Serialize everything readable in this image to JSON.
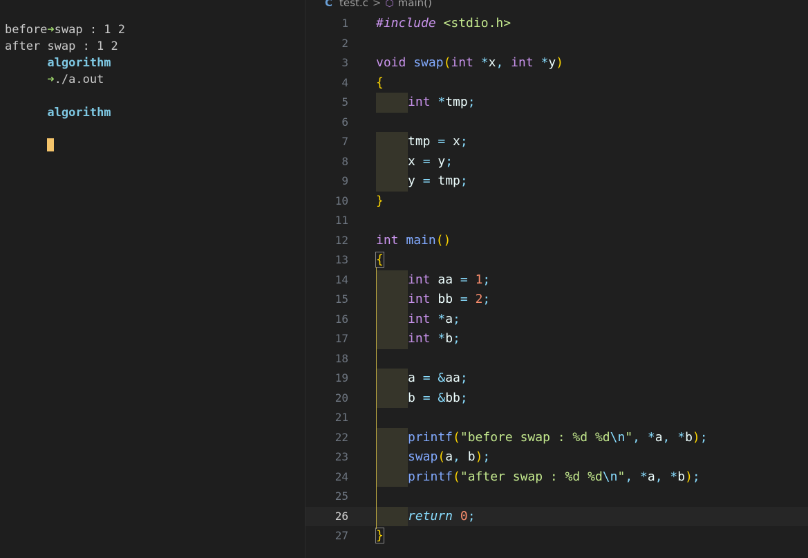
{
  "terminal": {
    "lines": [
      {
        "prompt": "➜",
        "dir": "algorithm",
        "cmd": " ./a.out"
      },
      {
        "text": "before swap : 1 2"
      },
      {
        "text": "after swap : 1 2"
      },
      {
        "prompt": "➜",
        "dir": "algorithm",
        "cmd": ""
      }
    ]
  },
  "editor": {
    "breadcrumb": {
      "file_icon": "C",
      "file": "test.c",
      "separator": ">",
      "symbol_icon": "cube-icon",
      "symbol": "main()"
    },
    "current_line": 26,
    "lines": [
      {
        "n": "1",
        "indent": 0,
        "tokens": [
          [
            "pre",
            "#include"
          ],
          [
            "",
            " "
          ],
          [
            "inc",
            "<stdio.h>"
          ]
        ]
      },
      {
        "n": "2",
        "indent": 0,
        "tokens": []
      },
      {
        "n": "3",
        "indent": 0,
        "tokens": [
          [
            "kw",
            "void"
          ],
          [
            "",
            " "
          ],
          [
            "fn",
            "swap"
          ],
          [
            "br",
            "("
          ],
          [
            "kw",
            "int"
          ],
          [
            "",
            " "
          ],
          [
            "op",
            "*"
          ],
          [
            "var",
            "x"
          ],
          [
            "punc",
            ","
          ],
          [
            "",
            " "
          ],
          [
            "kw",
            "int"
          ],
          [
            "",
            " "
          ],
          [
            "op",
            "*"
          ],
          [
            "var",
            "y"
          ],
          [
            "br",
            ")"
          ]
        ]
      },
      {
        "n": "4",
        "indent": 0,
        "tokens": [
          [
            "br",
            "{"
          ]
        ]
      },
      {
        "n": "5",
        "indent": 1,
        "tokens": [
          [
            "kw",
            "int"
          ],
          [
            "",
            " "
          ],
          [
            "op",
            "*"
          ],
          [
            "var",
            "tmp"
          ],
          [
            "punc",
            ";"
          ]
        ]
      },
      {
        "n": "6",
        "indent": 0,
        "tokens": []
      },
      {
        "n": "7",
        "indent": 1,
        "tokens": [
          [
            "var",
            "tmp"
          ],
          [
            "",
            " "
          ],
          [
            "op",
            "="
          ],
          [
            "",
            " "
          ],
          [
            "var",
            "x"
          ],
          [
            "punc",
            ";"
          ]
        ]
      },
      {
        "n": "8",
        "indent": 1,
        "tokens": [
          [
            "var",
            "x"
          ],
          [
            "",
            " "
          ],
          [
            "op",
            "="
          ],
          [
            "",
            " "
          ],
          [
            "var",
            "y"
          ],
          [
            "punc",
            ";"
          ]
        ]
      },
      {
        "n": "9",
        "indent": 1,
        "tokens": [
          [
            "var",
            "y"
          ],
          [
            "",
            " "
          ],
          [
            "op",
            "="
          ],
          [
            "",
            " "
          ],
          [
            "var",
            "tmp"
          ],
          [
            "punc",
            ";"
          ]
        ]
      },
      {
        "n": "10",
        "indent": 0,
        "tokens": [
          [
            "br",
            "}"
          ]
        ]
      },
      {
        "n": "11",
        "indent": 0,
        "tokens": []
      },
      {
        "n": "12",
        "indent": 0,
        "tokens": [
          [
            "kw",
            "int"
          ],
          [
            "",
            " "
          ],
          [
            "fn",
            "main"
          ],
          [
            "br",
            "()"
          ]
        ]
      },
      {
        "n": "13",
        "indent": 0,
        "tokens": [
          [
            "br",
            "{"
          ]
        ],
        "box": true
      },
      {
        "n": "14",
        "indent": 1,
        "tokens": [
          [
            "kw",
            "int"
          ],
          [
            "",
            " "
          ],
          [
            "var",
            "aa"
          ],
          [
            "",
            " "
          ],
          [
            "op",
            "="
          ],
          [
            "",
            " "
          ],
          [
            "num",
            "1"
          ],
          [
            "punc",
            ";"
          ]
        ]
      },
      {
        "n": "15",
        "indent": 1,
        "tokens": [
          [
            "kw",
            "int"
          ],
          [
            "",
            " "
          ],
          [
            "var",
            "bb"
          ],
          [
            "",
            " "
          ],
          [
            "op",
            "="
          ],
          [
            "",
            " "
          ],
          [
            "num",
            "2"
          ],
          [
            "punc",
            ";"
          ]
        ]
      },
      {
        "n": "16",
        "indent": 1,
        "tokens": [
          [
            "kw",
            "int"
          ],
          [
            "",
            " "
          ],
          [
            "op",
            "*"
          ],
          [
            "var",
            "a"
          ],
          [
            "punc",
            ";"
          ]
        ]
      },
      {
        "n": "17",
        "indent": 1,
        "tokens": [
          [
            "kw",
            "int"
          ],
          [
            "",
            " "
          ],
          [
            "op",
            "*"
          ],
          [
            "var",
            "b"
          ],
          [
            "punc",
            ";"
          ]
        ]
      },
      {
        "n": "18",
        "indent": 0,
        "tokens": []
      },
      {
        "n": "19",
        "indent": 1,
        "tokens": [
          [
            "var",
            "a"
          ],
          [
            "",
            " "
          ],
          [
            "op",
            "="
          ],
          [
            "",
            " "
          ],
          [
            "op",
            "&"
          ],
          [
            "var",
            "aa"
          ],
          [
            "punc",
            ";"
          ]
        ]
      },
      {
        "n": "20",
        "indent": 1,
        "tokens": [
          [
            "var",
            "b"
          ],
          [
            "",
            " "
          ],
          [
            "op",
            "="
          ],
          [
            "",
            " "
          ],
          [
            "op",
            "&"
          ],
          [
            "var",
            "bb"
          ],
          [
            "punc",
            ";"
          ]
        ]
      },
      {
        "n": "21",
        "indent": 0,
        "tokens": []
      },
      {
        "n": "22",
        "indent": 1,
        "tokens": [
          [
            "fn",
            "printf"
          ],
          [
            "br",
            "("
          ],
          [
            "str",
            "\"before swap : %d %d"
          ],
          [
            "esc",
            "\\n"
          ],
          [
            "str",
            "\""
          ],
          [
            "punc",
            ","
          ],
          [
            "",
            " "
          ],
          [
            "op",
            "*"
          ],
          [
            "var",
            "a"
          ],
          [
            "punc",
            ","
          ],
          [
            "",
            " "
          ],
          [
            "op",
            "*"
          ],
          [
            "var",
            "b"
          ],
          [
            "br",
            ")"
          ],
          [
            "punc",
            ";"
          ]
        ]
      },
      {
        "n": "23",
        "indent": 1,
        "tokens": [
          [
            "fn",
            "swap"
          ],
          [
            "br",
            "("
          ],
          [
            "var",
            "a"
          ],
          [
            "punc",
            ","
          ],
          [
            "",
            " "
          ],
          [
            "var",
            "b"
          ],
          [
            "br",
            ")"
          ],
          [
            "punc",
            ";"
          ]
        ]
      },
      {
        "n": "24",
        "indent": 1,
        "tokens": [
          [
            "fn",
            "printf"
          ],
          [
            "br",
            "("
          ],
          [
            "str",
            "\"after swap : %d %d"
          ],
          [
            "esc",
            "\\n"
          ],
          [
            "str",
            "\""
          ],
          [
            "punc",
            ","
          ],
          [
            "",
            " "
          ],
          [
            "op",
            "*"
          ],
          [
            "var",
            "a"
          ],
          [
            "punc",
            ","
          ],
          [
            "",
            " "
          ],
          [
            "op",
            "*"
          ],
          [
            "var",
            "b"
          ],
          [
            "br",
            ")"
          ],
          [
            "punc",
            ";"
          ]
        ]
      },
      {
        "n": "25",
        "indent": 0,
        "tokens": []
      },
      {
        "n": "26",
        "indent": 1,
        "tokens": [
          [
            "ret",
            "return"
          ],
          [
            "",
            " "
          ],
          [
            "num",
            "0"
          ],
          [
            "punc",
            ";"
          ]
        ]
      },
      {
        "n": "27",
        "indent": 0,
        "tokens": [
          [
            "br",
            "}"
          ]
        ],
        "box": true
      }
    ]
  },
  "colors": {
    "background": "#1e1e1e",
    "cursor": "#f4c46b",
    "prompt_arrow": "#9bd36b",
    "prompt_dir": "#7ec8e3"
  }
}
